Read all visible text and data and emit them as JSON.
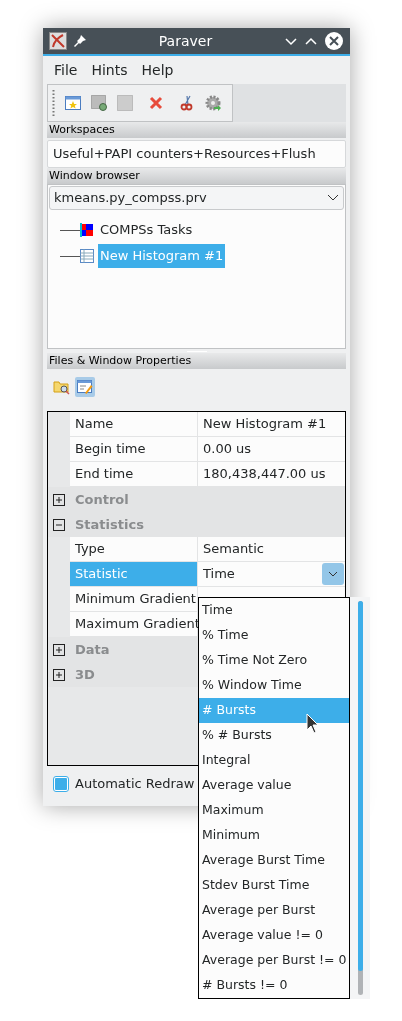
{
  "window": {
    "title": "Paraver"
  },
  "menu": [
    "File",
    "Hints",
    "Help"
  ],
  "workspaces": {
    "header": "Workspaces",
    "value": "Useful+PAPI counters+Resources+Flush"
  },
  "window_browser": {
    "header": "Window browser",
    "trace": "kmeans.py_compss.prv",
    "items": [
      {
        "label": "COMPSs Tasks",
        "kind": "timeline",
        "selected": false
      },
      {
        "label": "New Histogram #1",
        "kind": "histogram",
        "selected": true
      }
    ]
  },
  "properties_panel": {
    "header": "Files & Window Properties"
  },
  "properties": [
    {
      "kind": "property",
      "label": "Name",
      "value": "New Histogram #1",
      "selected": false
    },
    {
      "kind": "property",
      "label": "Begin time",
      "value": "0.00 us",
      "selected": false
    },
    {
      "kind": "property",
      "label": "End time",
      "value": "180,438,447.00 us",
      "selected": false
    },
    {
      "kind": "category",
      "label": "Control",
      "expanded": false
    },
    {
      "kind": "category",
      "label": "Statistics",
      "expanded": true
    },
    {
      "kind": "property",
      "label": "Type",
      "value": "Semantic",
      "selected": false
    },
    {
      "kind": "choice",
      "label": "Statistic",
      "value": "Time",
      "selected": true
    },
    {
      "kind": "property",
      "label": "Minimum Gradient",
      "selected": false
    },
    {
      "kind": "property",
      "label": "Maximum Gradient",
      "selected": false
    },
    {
      "kind": "category",
      "label": "Data",
      "expanded": false
    },
    {
      "kind": "category",
      "label": "3D",
      "expanded": false
    }
  ],
  "automatic_redraw": {
    "label": "Automatic Redraw",
    "checked": true
  },
  "dropdown": [
    {
      "label": "Time",
      "selected": false
    },
    {
      "label": "% Time",
      "selected": false
    },
    {
      "label": "% Time Not Zero",
      "selected": false
    },
    {
      "label": "% Window Time",
      "selected": false
    },
    {
      "label": "# Bursts",
      "selected": true
    },
    {
      "label": "% # Bursts",
      "selected": false
    },
    {
      "label": "Integral",
      "selected": false
    },
    {
      "label": "Average value",
      "selected": false
    },
    {
      "label": "Maximum",
      "selected": false
    },
    {
      "label": "Minimum",
      "selected": false
    },
    {
      "label": "Average Burst Time",
      "selected": false
    },
    {
      "label": "Stdev Burst Time",
      "selected": false
    },
    {
      "label": "Average per Burst",
      "selected": false
    },
    {
      "label": "Average value != 0",
      "selected": false
    },
    {
      "label": "Average per Burst != 0",
      "selected": false
    },
    {
      "label": "# Bursts != 0",
      "selected": false
    }
  ]
}
